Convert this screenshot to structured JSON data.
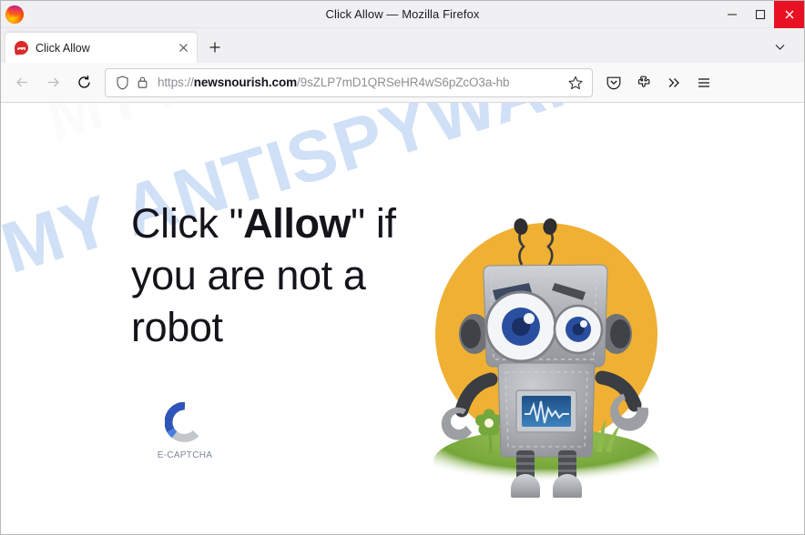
{
  "window": {
    "title": "Click Allow — Mozilla Firefox",
    "app_icon": "firefox-logo",
    "controls": {
      "minimize": "minimize-icon",
      "maximize": "maximize-icon",
      "close": "close-icon",
      "close_bg": "#e81123"
    }
  },
  "tabs": {
    "items": [
      {
        "title": "Click Allow",
        "favicon": "site-favicon",
        "close_label": "close-tab"
      }
    ],
    "new_tab_label": "new-tab",
    "list_all_label": "list-all-tabs"
  },
  "navigation": {
    "back_label": "back",
    "forward_label": "forward",
    "reload_label": "reload",
    "back_enabled": false,
    "forward_enabled": false
  },
  "urlbar": {
    "shield_icon": "tracking-protection-shield-icon",
    "lock_icon": "padlock-icon",
    "scheme": "https://",
    "domain": "newsnourish.com",
    "path": "/9sZLP7mD1QRSeHR4wS6pZcO3a-hb",
    "full_url": "https://newsnourish.com/9sZLP7mD1QRSeHR4wS6pZcO3a-hb",
    "bookmark_label": "bookmark-this-page"
  },
  "toolbar": {
    "pocket_label": "save-to-pocket",
    "extensions_label": "extensions",
    "overflow_label": "more-tools",
    "menu_label": "open-application-menu"
  },
  "page": {
    "headline_prefix": "Click \"",
    "headline_bold": "Allow",
    "headline_suffix": "\" if you are not a robot",
    "watermark": "MY ANTISPYWARE.COM",
    "watermark_color": "#c3d8f4",
    "captcha": {
      "label": "E-CAPTCHA",
      "logo_colors": {
        "arc_dark_blue": "#2f55b8",
        "arc_blue": "#4a7fe0",
        "arc_gray": "#c3c6cb"
      }
    },
    "robot": {
      "alt": "cartoon-robot-illustration",
      "circle_color": "#efb034",
      "body_color": "#a6a9ad",
      "eye_color": "#2b4fa0",
      "grass_color": "#7fae3e",
      "screen_color": "#2e6fa8"
    }
  }
}
